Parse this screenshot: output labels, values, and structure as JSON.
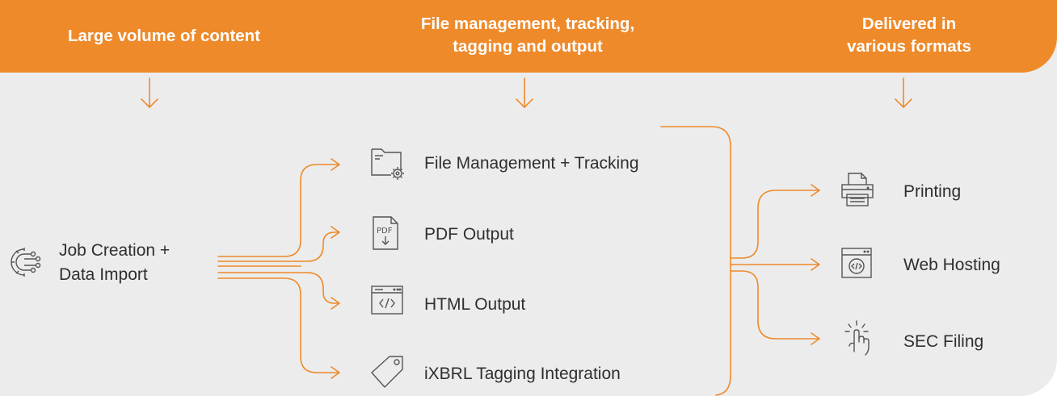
{
  "header": {
    "col1": "Large volume of content",
    "col2_line1": "File management, tracking,",
    "col2_line2": "tagging and output",
    "col3_line1": "Delivered in",
    "col3_line2": "various formats"
  },
  "source": {
    "line1": "Job Creation +",
    "line2": "Data Import",
    "icon": "gear-circuit-icon"
  },
  "processes": [
    {
      "label": "File Management + Tracking",
      "icon": "folder-gear-icon"
    },
    {
      "label": "PDF Output",
      "icon": "pdf-file-icon"
    },
    {
      "label": "HTML Output",
      "icon": "html-window-icon"
    },
    {
      "label": "iXBRL Tagging Integration",
      "icon": "tag-icon"
    }
  ],
  "outputs": [
    {
      "label": "Printing",
      "icon": "printer-icon"
    },
    {
      "label": "Web Hosting",
      "icon": "web-code-icon"
    },
    {
      "label": "SEC Filing",
      "icon": "click-hand-icon"
    }
  ],
  "colors": {
    "accent": "#ee8a2a",
    "background": "#ececec",
    "text": "#2f2f2f",
    "icon": "#555555"
  }
}
